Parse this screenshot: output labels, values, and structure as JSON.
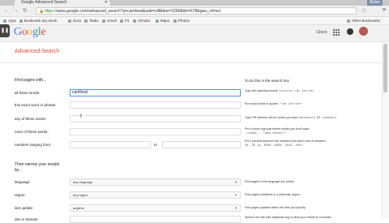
{
  "browser": {
    "tab_title": "Google Advanced Search",
    "user_badge": "Bates",
    "url_green": "https://",
    "url_rest": "www.google.com/advanced_search?q=cantheal&safe=off&biw=1258&bih=678&gws_rd=ssl",
    "bookmarks": [
      "Apps",
      "Bookmark any Book",
      "Docs",
      "Tasks",
      "Gmail",
      "Fit",
      "Scholar",
      "Maps",
      "Photos",
      "Other Bookmarks"
    ]
  },
  "header": {
    "logo_letters": [
      "G",
      "o",
      "o",
      "g",
      "l",
      "e"
    ],
    "logo_colors": [
      "#4285f4",
      "#ea4335",
      "#fbbc05",
      "#4285f4",
      "#34a853",
      "#ea4335"
    ],
    "link": "Gbest"
  },
  "page": {
    "title": "Advanced Search",
    "find_heading": "Find pages with...",
    "do_heading": "To do this in the search box",
    "narrow_heading": "Then narrow your results by..."
  },
  "find_rows": [
    {
      "label": "all these words:",
      "value": "cantheal",
      "hint": "Type the important words:",
      "hint_example": "tricolor rat terrier"
    },
    {
      "label": "this exact word or phrase:",
      "value": "",
      "hint": "Put exact words in quotes:",
      "hint_example": "\"rat terrier\""
    },
    {
      "label": "any of these words:",
      "value": "",
      "hint": "Type OR between all the words you want:",
      "hint_example": "miniature OR standard"
    },
    {
      "label": "none of these words:",
      "value": "",
      "hint": "Put a minus sign just before words you don't want:",
      "hint_example": "-rodent, -\"Jack Russell\""
    },
    {
      "label": "numbers ranging from:",
      "value": "",
      "hint": "Put 2 periods between the numbers and add a unit of measure:",
      "hint_example": "10..35 lb, $300..$500, 2010..2011"
    }
  ],
  "range_to": "to",
  "narrow_rows": [
    {
      "label": "language:",
      "value": "any language",
      "hint": "Find pages in the language you select."
    },
    {
      "label": "region:",
      "value": "any region",
      "hint": "Find pages published in a particular region."
    },
    {
      "label": "last update:",
      "value": "anytime",
      "hint": "Find pages updated within the time you specify."
    },
    {
      "label": "site or domain:",
      "value": "",
      "hint": "Search one site (like wikipedia.org) or limit your results to a domain"
    }
  ]
}
